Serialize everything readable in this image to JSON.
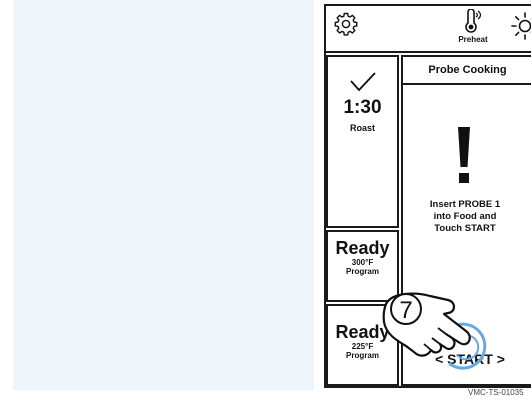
{
  "topbar": {
    "settings_icon": "gear-icon",
    "preheat_icon": "thermometer-icon",
    "preheat_label": "Preheat",
    "light_icon": "sun-icon"
  },
  "sidebar": {
    "roast": {
      "icon": "checkmark-icon",
      "time": "1:30",
      "mode": "Roast"
    },
    "ready1": {
      "status": "Ready",
      "temp": "300°F",
      "label": "Program"
    },
    "ready2": {
      "status": "Ready",
      "temp": "225°F",
      "label": "Program"
    }
  },
  "main": {
    "title": "Probe Cooking",
    "alert_icon": "exclamation-icon",
    "instruction_line1": "Insert PROBE 1",
    "instruction_line2": "into Food  and",
    "instruction_line3": "Touch START",
    "start_label": "< START >"
  },
  "callout": {
    "step_number": "7",
    "icon": "tap-hand-icon"
  },
  "figure_code": "VMC-TS-01035"
}
